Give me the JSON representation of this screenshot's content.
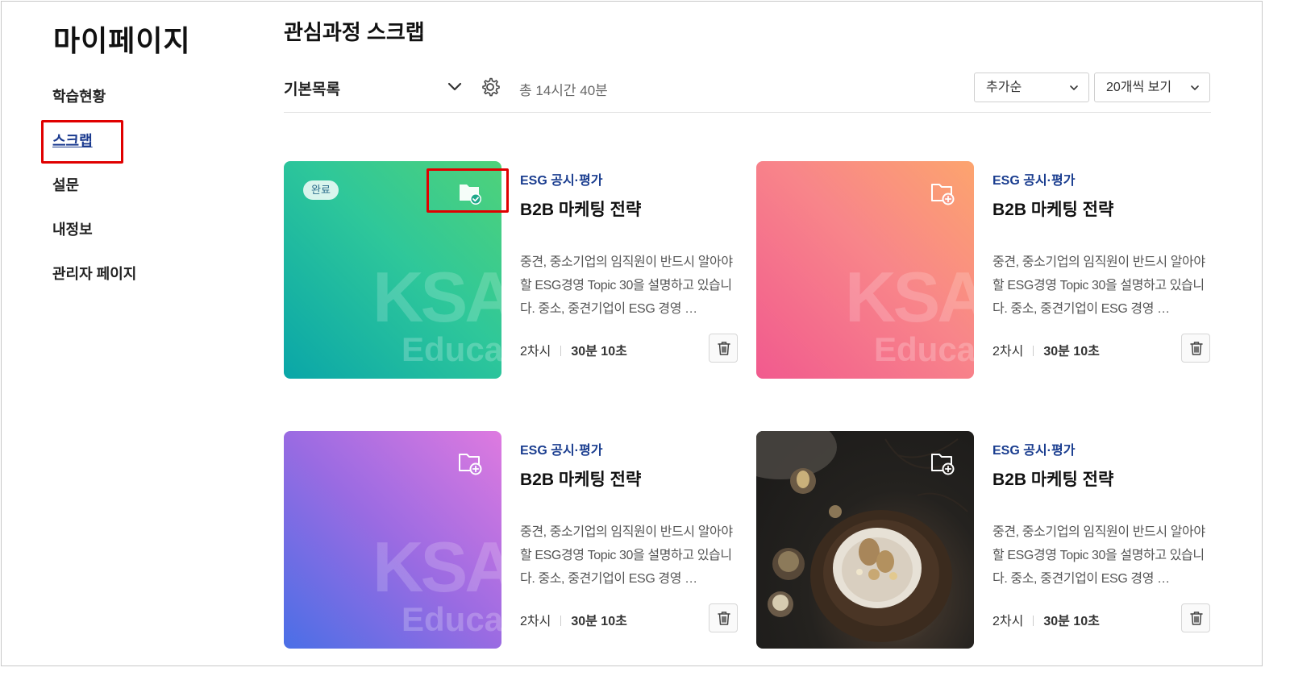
{
  "sidebar": {
    "title": "마이페이지",
    "items": [
      {
        "label": "학습현황"
      },
      {
        "label": "스크랩"
      },
      {
        "label": "설문"
      },
      {
        "label": "내정보"
      },
      {
        "label": "관리자 페이지"
      }
    ],
    "active_index": 1
  },
  "header": {
    "title": "관심과정 스크랩",
    "list_name": "기본목록",
    "total_time": "총 14시간 40분",
    "sort": {
      "selected": "추가순"
    },
    "page_size": {
      "selected": "20개씩 보기"
    }
  },
  "cards": [
    {
      "category": "ESG 공시·평가",
      "title": "B2B 마케팅 전략",
      "desc": "중견, 중소기업의 임직원이 반드시 알아야 할 ESG경영 Topic 30을 설명하고 있습니다. 중소, 중견기업이 ESG 경영 …",
      "sessions": "2차시",
      "duration": "30분 10초",
      "status": "완료",
      "scrapped": true,
      "thumb": "gradient-teal",
      "watermark1": "KSA",
      "watermark2": "Educa"
    },
    {
      "category": "ESG 공시·평가",
      "title": "B2B 마케팅 전략",
      "desc": "중견, 중소기업의 임직원이 반드시 알아야 할 ESG경영 Topic 30을 설명하고 있습니다. 중소, 중견기업이 ESG 경영 …",
      "sessions": "2차시",
      "duration": "30분 10초",
      "status": "",
      "scrapped": false,
      "thumb": "gradient-coral",
      "watermark1": "KSA",
      "watermark2": "Educa"
    },
    {
      "category": "ESG 공시·평가",
      "title": "B2B 마케팅 전략",
      "desc": "중견, 중소기업의 임직원이 반드시 알아야 할 ESG경영 Topic 30을 설명하고 있습니다. 중소, 중견기업이 ESG 경영 …",
      "sessions": "2차시",
      "duration": "30분 10초",
      "status": "",
      "scrapped": false,
      "thumb": "gradient-violet",
      "watermark1": "KSA",
      "watermark2": "Educa"
    },
    {
      "category": "ESG 공시·평가",
      "title": "B2B 마케팅 전략",
      "desc": "중견, 중소기업의 임직원이 반드시 알아야 할 ESG경영 Topic 30을 설명하고 있습니다. 중소, 중견기업이 ESG 경영 …",
      "sessions": "2차시",
      "duration": "30분 10초",
      "status": "",
      "scrapped": false,
      "thumb": "photo-cake",
      "watermark1": "",
      "watermark2": ""
    }
  ],
  "icons": {
    "list_toggle": "chevron-down-icon",
    "settings": "gear-icon",
    "scrap_done": "folder-check-icon",
    "scrap_add": "folder-plus-icon",
    "delete": "trash-icon"
  },
  "colors": {
    "highlight": "#e00000",
    "category": "#1a3d8f",
    "active_link": "#1a3a8f"
  }
}
